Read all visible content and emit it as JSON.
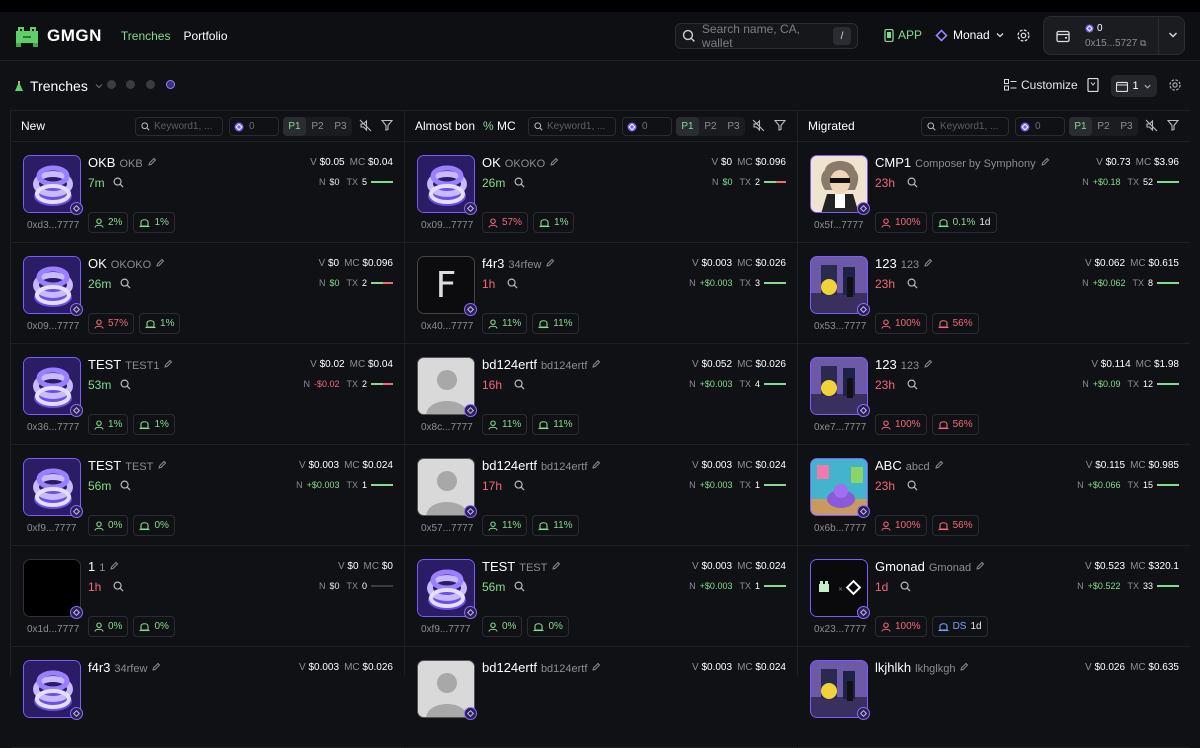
{
  "header": {
    "brand": "GMGN",
    "nav": [
      "Trenches",
      "Portfolio"
    ],
    "search_placeholder": "Search name, CA, wallet",
    "search_shortcut": "/",
    "app_label": "APP",
    "chain": "Monad",
    "wallet": {
      "balance": "0",
      "address": "0x15...5727"
    }
  },
  "subbar": {
    "title": "Trenches",
    "customize": "Customize",
    "count": "1"
  },
  "columns": [
    {
      "title": "New",
      "keyword_placeholder": "Keyword1, ...",
      "min_value": "0",
      "pages": [
        "P1",
        "P2",
        "P3"
      ],
      "cards": [
        {
          "name": "OKB",
          "symbol": "OKB",
          "age": "7m",
          "age_color": "g",
          "ca": "0xd3...7777",
          "v": "$0.05",
          "mc": "$0.04",
          "n": "$0",
          "n_sign": "zer",
          "tx": "5",
          "chips": [
            {
              "c": "g",
              "t": "2%"
            },
            {
              "c": "g",
              "t": "1%"
            }
          ],
          "avatar": "logo"
        },
        {
          "name": "OK",
          "symbol": "OKOKO",
          "age": "26m",
          "age_color": "g",
          "ca": "0x09...7777",
          "v": "$0",
          "mc": "$0.096",
          "n": "$0",
          "n_sign": "pos",
          "tx": "2",
          "chips": [
            {
              "c": "r",
              "t": "57%"
            },
            {
              "c": "g",
              "t": "1%"
            }
          ],
          "avatar": "logo"
        },
        {
          "name": "TEST",
          "symbol": "TEST1",
          "age": "53m",
          "age_color": "g",
          "ca": "0x36...7777",
          "v": "$0.02",
          "mc": "$0.04",
          "n": "-$0.02",
          "n_sign": "neg",
          "tx": "2",
          "chips": [
            {
              "c": "g",
              "t": "1%"
            },
            {
              "c": "g",
              "t": "1%"
            }
          ],
          "avatar": "logo"
        },
        {
          "name": "TEST",
          "symbol": "TEST",
          "age": "56m",
          "age_color": "g",
          "ca": "0xf9...7777",
          "v": "$0.003",
          "mc": "$0.024",
          "n": "+$0.003",
          "n_sign": "pos",
          "tx": "1",
          "chips": [
            {
              "c": "g",
              "t": "0%"
            },
            {
              "c": "g",
              "t": "0%"
            }
          ],
          "avatar": "logo"
        },
        {
          "name": "1",
          "symbol": "1",
          "age": "1h",
          "age_color": "r",
          "ca": "0x1d...7777",
          "v": "$0",
          "mc": "$0",
          "n": "$0",
          "n_sign": "zer",
          "tx": "0",
          "chips": [
            {
              "c": "g",
              "t": "0%"
            },
            {
              "c": "g",
              "t": "0%"
            }
          ],
          "avatar": "black"
        },
        {
          "name": "f4r3",
          "symbol": "34rfew",
          "age": "",
          "age_color": "g",
          "ca": "",
          "v": "$0.003",
          "mc": "$0.026",
          "n": "",
          "n_sign": "zer",
          "tx": "",
          "chips": [],
          "avatar": "logo"
        }
      ]
    },
    {
      "title": "Almost bonded",
      "mc_label": "MC",
      "keyword_placeholder": "Keyword1, ...",
      "min_value": "0",
      "pages": [
        "P1",
        "P2",
        "P3"
      ],
      "cards": [
        {
          "name": "OK",
          "symbol": "OKOKO",
          "age": "26m",
          "age_color": "g",
          "ca": "0x09...7777",
          "v": "$0",
          "mc": "$0.096",
          "n": "$0",
          "n_sign": "pos",
          "tx": "2",
          "chips": [
            {
              "c": "r",
              "t": "57%"
            },
            {
              "c": "g",
              "t": "1%"
            }
          ],
          "avatar": "logo"
        },
        {
          "name": "f4r3",
          "symbol": "34rfew",
          "age": "1h",
          "age_color": "r",
          "ca": "0x40...7777",
          "v": "$0.003",
          "mc": "$0.026",
          "n": "+$0.003",
          "n_sign": "pos",
          "tx": "3",
          "chips": [
            {
              "c": "g",
              "t": "11%"
            },
            {
              "c": "g",
              "t": "11%"
            }
          ],
          "avatar": "f"
        },
        {
          "name": "bd124ertf",
          "symbol": "bd124ertf",
          "age": "16h",
          "age_color": "r",
          "ca": "0x8c...7777",
          "v": "$0.052",
          "mc": "$0.026",
          "n": "+$0.003",
          "n_sign": "pos",
          "tx": "4",
          "chips": [
            {
              "c": "g",
              "t": "11%"
            },
            {
              "c": "g",
              "t": "11%"
            }
          ],
          "avatar": "gray"
        },
        {
          "name": "bd124ertf",
          "symbol": "bd124ertf",
          "age": "17h",
          "age_color": "r",
          "ca": "0x57...7777",
          "v": "$0.003",
          "mc": "$0.024",
          "n": "+$0.003",
          "n_sign": "pos",
          "tx": "1",
          "chips": [
            {
              "c": "g",
              "t": "11%"
            },
            {
              "c": "g",
              "t": "11%"
            }
          ],
          "avatar": "gray"
        },
        {
          "name": "TEST",
          "symbol": "TEST",
          "age": "56m",
          "age_color": "g",
          "ca": "0xf9...7777",
          "v": "$0.003",
          "mc": "$0.024",
          "n": "+$0.003",
          "n_sign": "pos",
          "tx": "1",
          "chips": [
            {
              "c": "g",
              "t": "0%"
            },
            {
              "c": "g",
              "t": "0%"
            }
          ],
          "avatar": "logo"
        },
        {
          "name": "bd124ertf",
          "symbol": "bd124ertf",
          "age": "",
          "age_color": "r",
          "ca": "",
          "v": "$0.003",
          "mc": "$0.024",
          "n": "",
          "n_sign": "zer",
          "tx": "",
          "chips": [],
          "avatar": "gray"
        }
      ]
    },
    {
      "title": "Migrated",
      "keyword_placeholder": "Keyword1, ...",
      "min_value": "0",
      "pages": [
        "P1",
        "P2",
        "P3"
      ],
      "cards": [
        {
          "name": "CMP1",
          "symbol": "Composer by Symphony",
          "age": "23h",
          "age_color": "r",
          "ca": "0x5f...7777",
          "v": "$0.73",
          "mc": "$3.96",
          "n": "+$0.18",
          "n_sign": "pos",
          "tx": "52",
          "chips": [
            {
              "c": "r",
              "t": "100%"
            },
            {
              "c": "g",
              "t": "0.1%",
              "extra": "1d"
            }
          ],
          "avatar": "art"
        },
        {
          "name": "123",
          "symbol": "123",
          "age": "23h",
          "age_color": "r",
          "ca": "0x53...7777",
          "v": "$0.062",
          "mc": "$0.615",
          "n": "+$0.062",
          "n_sign": "pos",
          "tx": "8",
          "chips": [
            {
              "c": "r",
              "t": "100%"
            },
            {
              "c": "r",
              "t": "56%"
            }
          ],
          "avatar": "pix"
        },
        {
          "name": "123",
          "symbol": "123",
          "age": "23h",
          "age_color": "r",
          "ca": "0xe7...7777",
          "v": "$0.114",
          "mc": "$1.98",
          "n": "+$0.09",
          "n_sign": "pos",
          "tx": "12",
          "chips": [
            {
              "c": "r",
              "t": "100%"
            },
            {
              "c": "r",
              "t": "56%"
            }
          ],
          "avatar": "pix"
        },
        {
          "name": "ABC",
          "symbol": "abcd",
          "age": "23h",
          "age_color": "r",
          "ca": "0x6b...7777",
          "v": "$0.115",
          "mc": "$0.985",
          "n": "+$0.066",
          "n_sign": "pos",
          "tx": "15",
          "chips": [
            {
              "c": "r",
              "t": "100%"
            },
            {
              "c": "r",
              "t": "56%"
            }
          ],
          "avatar": "room"
        },
        {
          "name": "Gmonad",
          "symbol": "Gmonad",
          "age": "1d",
          "age_color": "r",
          "ca": "0x23...7777",
          "v": "$0.523",
          "mc": "$320.1",
          "n": "+$0.522",
          "n_sign": "pos",
          "tx": "33",
          "chips": [
            {
              "c": "r",
              "t": "100%"
            },
            {
              "c": "b",
              "t": "DS",
              "extra": "1d"
            }
          ],
          "avatar": "gm"
        },
        {
          "name": "lkjhlkh",
          "symbol": "lkhglkgh",
          "age": "",
          "age_color": "r",
          "ca": "",
          "v": "$0.026",
          "mc": "$0.635",
          "n": "",
          "n_sign": "zer",
          "tx": "",
          "chips": [],
          "avatar": "pix"
        }
      ]
    }
  ]
}
